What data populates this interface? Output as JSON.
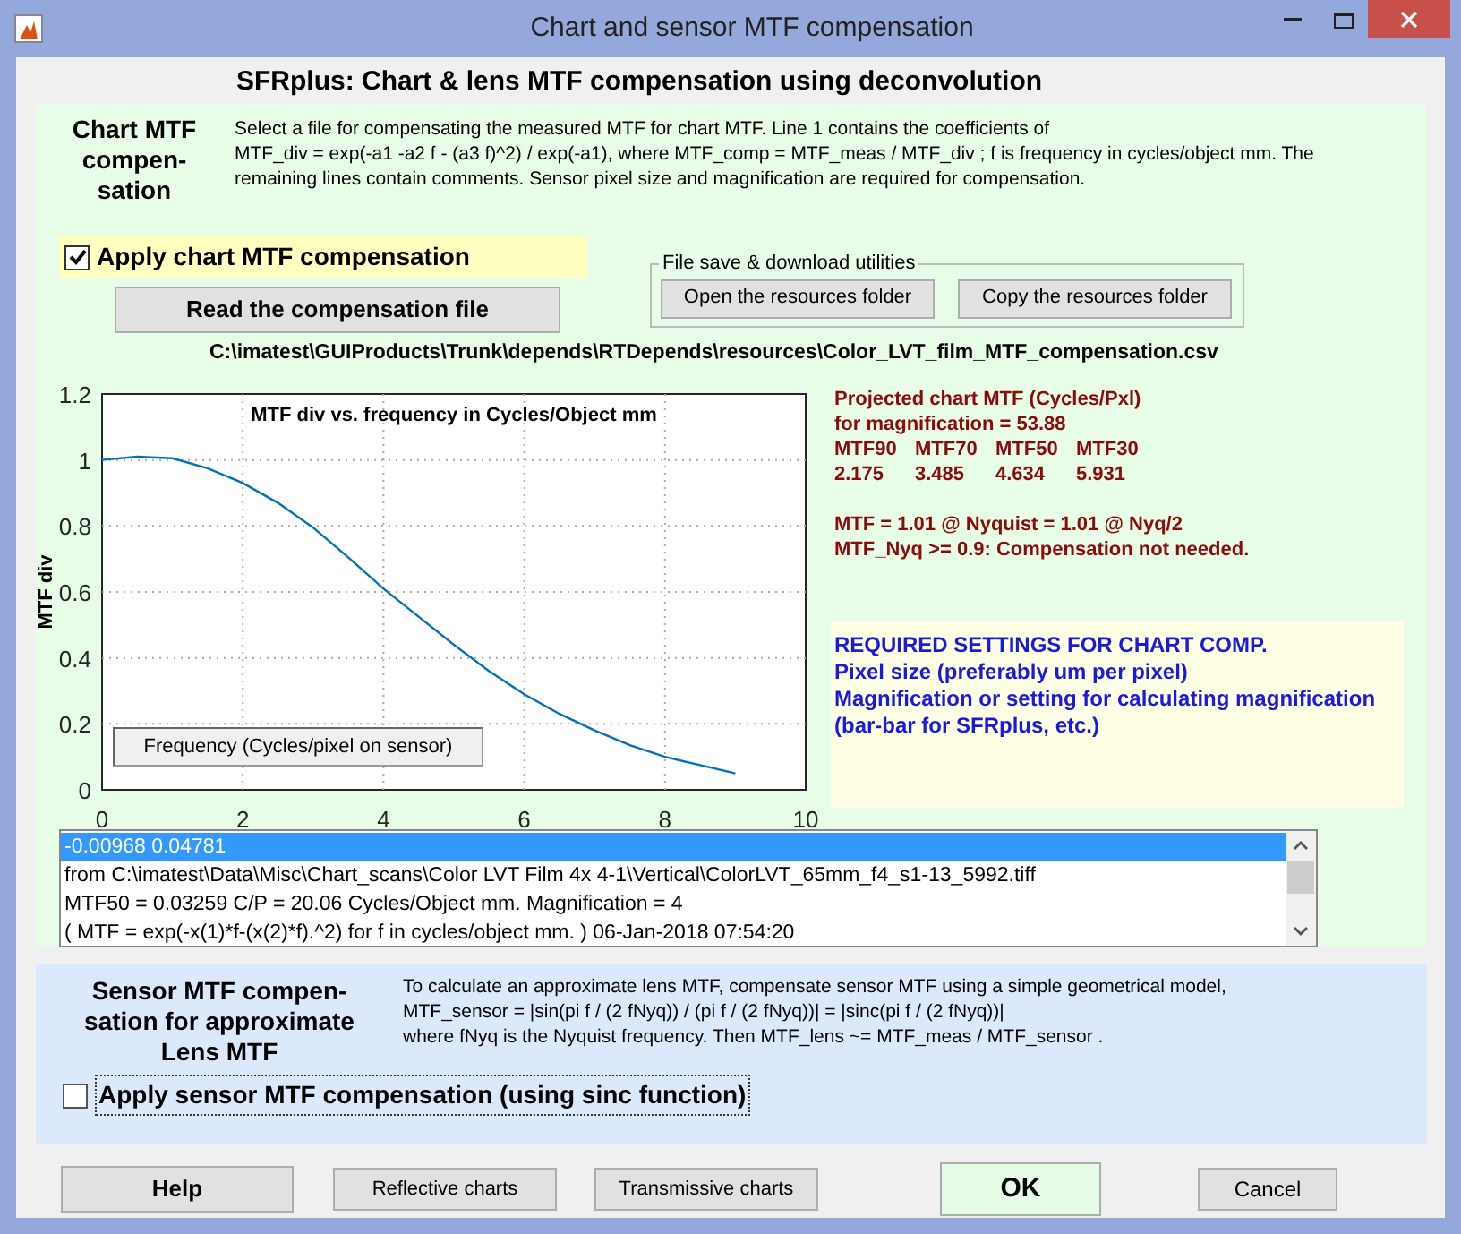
{
  "window": {
    "title": "Chart and sensor MTF compensation"
  },
  "heading": "SFRplus:  Chart & lens MTF compensation using deconvolution",
  "chart_section": {
    "title_lines": [
      "Chart MTF",
      "compen-",
      "sation"
    ],
    "description_lines": [
      "Select a file for compensating the measured MTF for chart MTF.  Line 1 contains the coefficients of",
      "MTF_div = exp(-a1 -a2 f - (a3 f)^2) / exp(-a1),  where MTF_comp = MTF_meas / MTF_div ;  f is frequency in cycles/object mm. The",
      "remaining lines contain comments.  Sensor pixel size and magnification are required for compensation."
    ],
    "checkbox": {
      "label": "Apply chart MTF compensation",
      "checked": true
    },
    "read_button": "Read the compensation file",
    "utilities": {
      "legend": "File save & download utilities",
      "buttons": [
        "Open the resources folder",
        "Copy the resources folder"
      ]
    },
    "file_path": "C:\\imatest\\GUIProducts\\Trunk\\depends\\RTDepends\\resources\\Color_LVT_film_MTF_compensation.csv",
    "chart_data": {
      "type": "line",
      "title": "MTF div vs. frequency in Cycles/Object mm",
      "xlabel": "Frequency (Cycles/pixel on sensor)",
      "ylabel": "MTF div",
      "x": [
        0,
        0.5,
        1,
        1.5,
        2,
        2.5,
        3,
        3.5,
        4,
        4.5,
        5,
        5.5,
        6,
        6.5,
        7,
        7.5,
        8,
        8.5,
        9
      ],
      "series": [
        {
          "color": "#0072bd",
          "values": [
            1.0,
            1.01,
            1.005,
            0.975,
            0.93,
            0.87,
            0.795,
            0.705,
            0.61,
            0.525,
            0.44,
            0.36,
            0.29,
            0.23,
            0.18,
            0.135,
            0.1,
            0.075,
            0.05
          ]
        }
      ],
      "grid": true,
      "xlim": [
        0,
        10
      ],
      "ylim": [
        0,
        1.2
      ],
      "xticks": [
        {
          "value": 0,
          "label": "0"
        },
        {
          "value": 2,
          "label": "2"
        },
        {
          "value": 4,
          "label": "4"
        },
        {
          "value": 6,
          "label": "6"
        },
        {
          "value": 8,
          "label": "8"
        },
        {
          "value": 10,
          "label": "10"
        }
      ],
      "yticks": [
        {
          "value": 0,
          "label": "0"
        },
        {
          "value": 0.2,
          "label": "0.2"
        },
        {
          "value": 0.4,
          "label": "0.4"
        },
        {
          "value": 0.6,
          "label": "0.6"
        },
        {
          "value": 0.8,
          "label": "0.8"
        },
        {
          "value": 1,
          "label": "1"
        },
        {
          "value": 1.2,
          "label": "1.2"
        }
      ]
    },
    "results": {
      "lines": [
        "Projected chart MTF (Cycles/Pxl)",
        "for magnification = 53.88"
      ],
      "metrics": [
        {
          "name": "MTF90",
          "value": "2.175"
        },
        {
          "name": "MTF70",
          "value": "3.485"
        },
        {
          "name": "MTF50",
          "value": "4.634"
        },
        {
          "name": "MTF30",
          "value": "5.931"
        }
      ],
      "notes": [
        "MTF = 1.01 @ Nyquist = 1.01 @ Nyq/2",
        "MTF_Nyq >= 0.9:  Compensation not needed."
      ]
    },
    "required_lines": [
      "REQUIRED SETTINGS FOR CHART COMP.",
      "Pixel size (preferably um per pixel)",
      "Magnification or setting for calculating magnification",
      "(bar-bar for SFRplus, etc.)"
    ]
  },
  "file_contents": [
    {
      "text": "-0.00968  0.04781",
      "selected": true
    },
    {
      "text": "from  C:\\imatest\\Data\\Misc\\Chart_scans\\Color LVT Film 4x 4-1\\Vertical\\ColorLVT_65mm_f4_s1-13_5992.tiff",
      "selected": false
    },
    {
      "text": "MTF50 = 0.03259 C/P  = 20.06 Cycles/Object mm.  Magnification = 4",
      "selected": false
    },
    {
      "text": "( MTF = exp(-x(1)*f-(x(2)*f).^2) for f in cycles/object mm. )  06-Jan-2018 07:54:20",
      "selected": false
    }
  ],
  "sensor_section": {
    "title_lines": [
      "Sensor MTF compen-",
      "sation for approximate",
      "Lens MTF"
    ],
    "description_lines": [
      "To calculate an approximate lens MTF, compensate sensor MTF using a simple geometrical model,",
      "MTF_sensor = |sin(pi f / (2 fNyq)) / (pi f / (2 fNyq))| = |sinc(pi f / (2 fNyq))|",
      "where fNyq is the Nyquist frequency.  Then  MTF_lens ~= MTF_meas / MTF_sensor ."
    ],
    "checkbox": {
      "label": "Apply sensor MTF compensation (using sinc function)",
      "checked": false
    }
  },
  "buttons": [
    {
      "label": "Help",
      "kind": "bold"
    },
    {
      "label": "Reflective charts",
      "kind": "small"
    },
    {
      "label": "Transmissive charts",
      "kind": "small"
    },
    {
      "label": "OK",
      "kind": "primary"
    },
    {
      "label": "Cancel",
      "kind": "normal"
    }
  ]
}
